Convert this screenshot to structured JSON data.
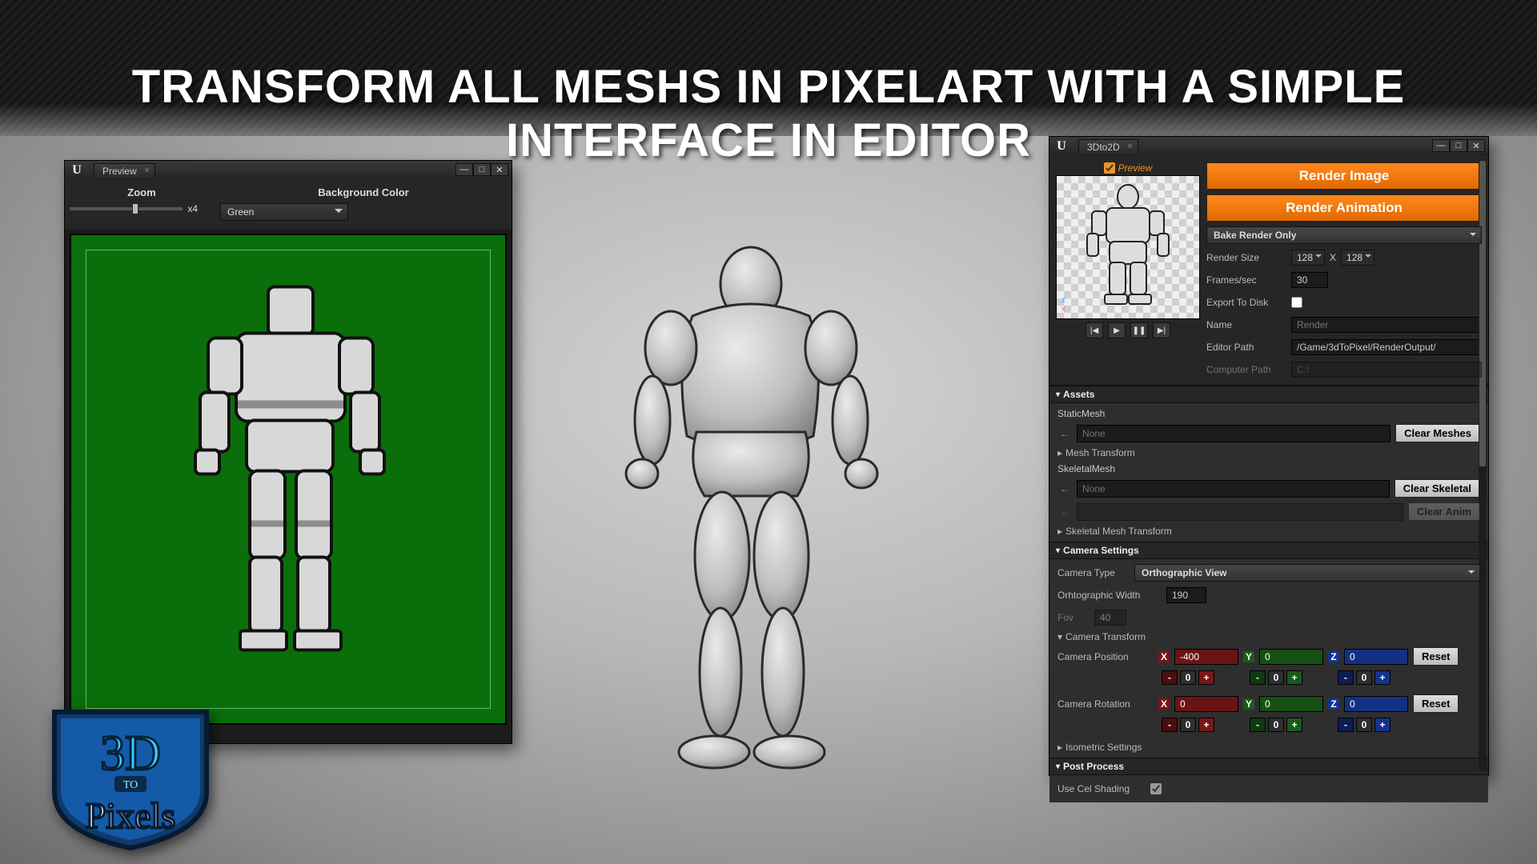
{
  "headline": "TRANSFORM ALL MESHS IN PIXELART WITH A SIMPLE INTERFACE IN EDITOR",
  "previewWindow": {
    "tab": "Preview",
    "zoom": {
      "label": "Zoom",
      "value": "x4"
    },
    "bgcolor": {
      "label": "Background Color",
      "value": "Green"
    }
  },
  "mainWindow": {
    "tab": "3Dto2D",
    "previewCheck": "Preview",
    "renderImage": "Render Image",
    "renderAnimation": "Render Animation",
    "bakeMode": "Bake Render Only",
    "renderSize": {
      "label": "Render Size",
      "w": "128",
      "h": "128",
      "sep": "X"
    },
    "fps": {
      "label": "Frames/sec",
      "value": "30"
    },
    "exportToDisk": {
      "label": "Export To Disk"
    },
    "name": {
      "label": "Name",
      "value": "Render"
    },
    "editorPath": {
      "label": "Editor Path",
      "value": "/Game/3dToPixel/RenderOutput/"
    },
    "computerPath": {
      "label": "Computer Path",
      "value": "C:\\"
    },
    "assets": {
      "header": "Assets",
      "staticMesh": "StaticMesh",
      "staticMeshVal": "None",
      "clearMeshes": "Clear Meshes",
      "meshTransform": "Mesh Transform",
      "skeletalMesh": "SkeletalMesh",
      "skeletalMeshVal": "None",
      "clearSkeletal": "Clear Skeletal",
      "clearAnim": "Clear Anim",
      "skeletalMeshTransform": "Skeletal Mesh Transform"
    },
    "camera": {
      "header": "Camera Settings",
      "typeLabel": "Camera Type",
      "typeValue": "Orthographic View",
      "orthoWidthLabel": "Orhtographic Width",
      "orthoWidthValue": "190",
      "fovLabel": "Fov",
      "fovValue": "40",
      "transformHeader": "Camera Transform",
      "position": {
        "label": "Camera Position",
        "x": "-400",
        "y": "0",
        "z": "0",
        "reset": "Reset"
      },
      "rotation": {
        "label": "Camera Rotation",
        "x": "0",
        "y": "0",
        "z": "0",
        "reset": "Reset"
      },
      "spinZero": "0",
      "isometric": "Isometric Settings"
    },
    "postProcess": {
      "header": "Post Process",
      "celShading": "Use Cel Shading"
    }
  },
  "badge": {
    "top": "3D",
    "mid": "TO",
    "bottom": "Pixels"
  }
}
